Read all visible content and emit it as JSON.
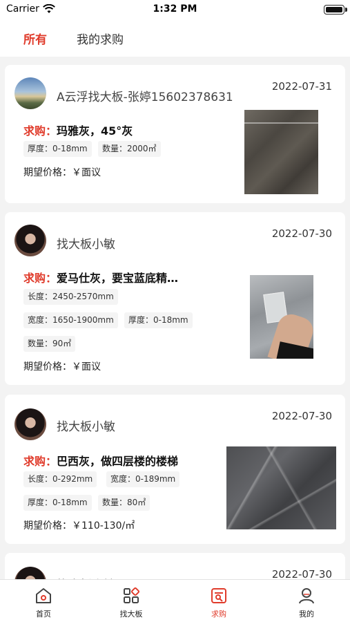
{
  "status_bar": {
    "carrier": "Carrier",
    "time": "1:32 PM"
  },
  "tabs": [
    {
      "label": "所有",
      "active": true
    },
    {
      "label": "我的求购",
      "active": false
    }
  ],
  "accent_color": "#e03b2b",
  "posts": [
    {
      "name": "A云浮找大板-张婷15602378631",
      "date": "2022-07-31",
      "prefix": "求购：",
      "title": "玛雅灰，45°灰",
      "tags": [
        "厚度：0-18mm",
        "数量：2000㎡"
      ],
      "price": "期望价格：￥面议"
    },
    {
      "name": "找大板小敏",
      "date": "2022-07-30",
      "prefix": "求购：",
      "title": "爱马仕灰，要宝蓝底精…",
      "tags": [
        "长度：2450-2570mm",
        "宽度：1650-1900mm",
        "厚度：0-18mm",
        "数量：90㎡"
      ],
      "price": "期望价格：￥面议"
    },
    {
      "name": "找大板小敏",
      "date": "2022-07-30",
      "prefix": "求购：",
      "title": "巴西灰，做四层楼的楼梯",
      "tags": [
        "长度：0-292mm",
        "宽度：0-189mm",
        "厚度：0-18mm",
        "数量：80㎡"
      ],
      "price": "期望价格：￥110-130/㎡"
    },
    {
      "name": "找大板小敏",
      "date": "2022-07-30"
    }
  ],
  "tabbar": [
    {
      "label": "首页",
      "icon": "home-icon",
      "active": false
    },
    {
      "label": "找大板",
      "icon": "grid-icon",
      "active": false
    },
    {
      "label": "求购",
      "icon": "purchase-icon",
      "active": true
    },
    {
      "label": "我的",
      "icon": "user-icon",
      "active": false
    }
  ]
}
